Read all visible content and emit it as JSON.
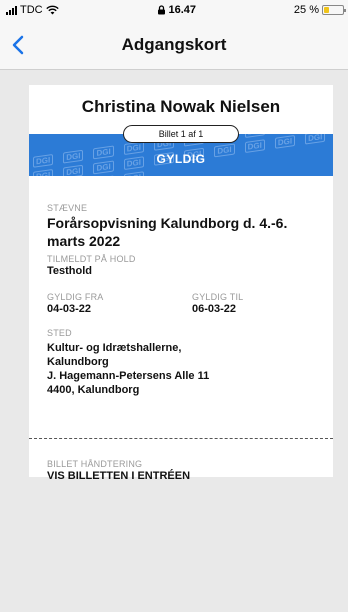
{
  "status_bar": {
    "carrier": "TDC",
    "time": "16.47",
    "battery_percent": "25 %",
    "battery_level": 0.25,
    "battery_color": "#f0c419"
  },
  "nav": {
    "title": "Adgangskort",
    "back_icon": "chevron-left-icon"
  },
  "ticket": {
    "holder_name": "Christina Nowak Nielsen",
    "count_label": "Billet 1 af 1",
    "status": "GYLDIG",
    "band_color": "#2c7bd6",
    "band_pattern_text": "DGI",
    "event_label": "STÆVNE",
    "event_name": "Forårsopvisning Kalundborg d. 4.-6. marts 2022",
    "registered_label": "TILMELDT PÅ HOLD",
    "registered_value": "Testhold",
    "valid_from_label": "GYLDIG FRA",
    "valid_from_value": "04-03-22",
    "valid_to_label": "GYLDIG TIL",
    "valid_to_value": "06-03-22",
    "place_label": "STED",
    "place_lines": [
      "Kultur- og Idrætshallerne,",
      "Kalundborg",
      "J. Hagemann-Petersens Alle 11",
      "4400, Kalundborg"
    ],
    "handling_label": "BILLET HÅNDTERING",
    "handling_value": "VIS BILLETTEN I ENTRÉEN"
  }
}
